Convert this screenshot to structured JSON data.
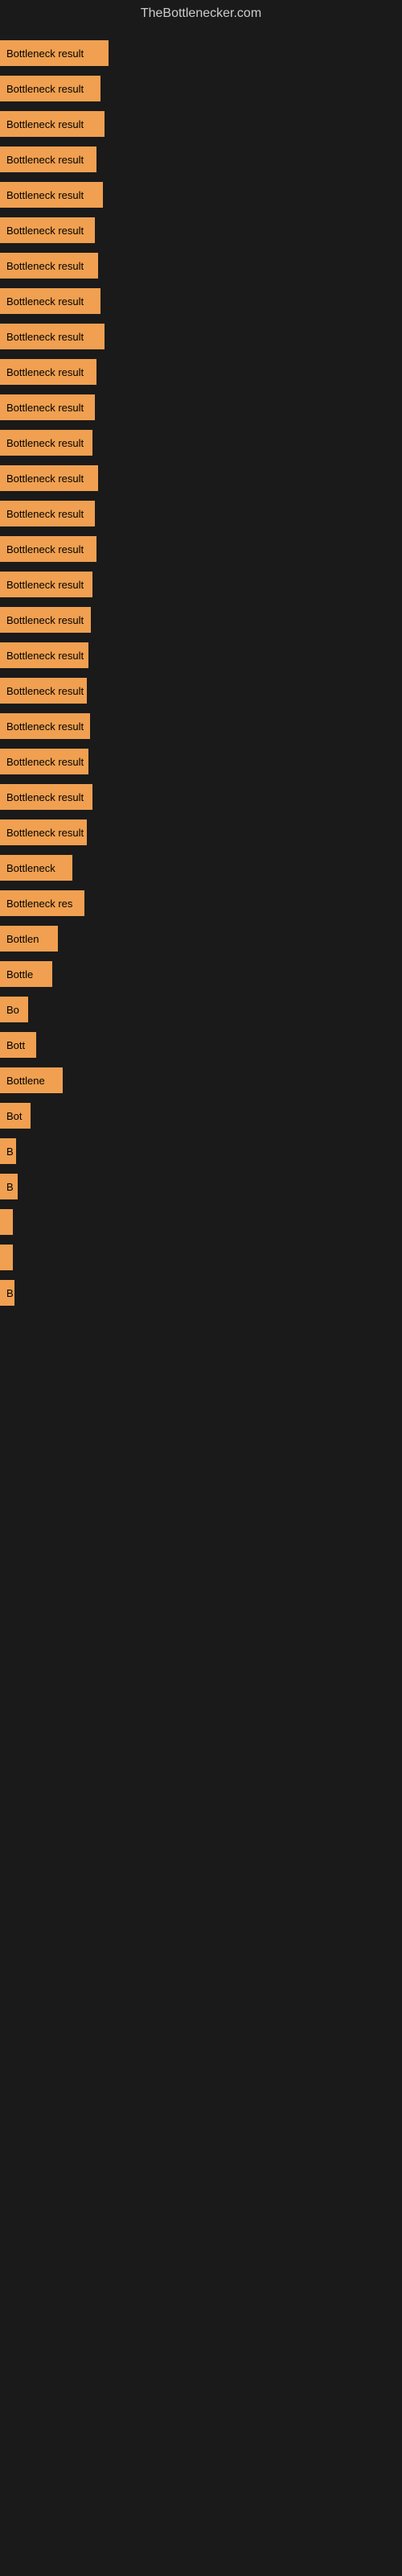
{
  "site": {
    "title": "TheBottlenecker.com"
  },
  "bars": [
    {
      "label": "Bottleneck result",
      "width": 135
    },
    {
      "label": "Bottleneck result",
      "width": 125
    },
    {
      "label": "Bottleneck result",
      "width": 130
    },
    {
      "label": "Bottleneck result",
      "width": 120
    },
    {
      "label": "Bottleneck result",
      "width": 128
    },
    {
      "label": "Bottleneck result",
      "width": 118
    },
    {
      "label": "Bottleneck result",
      "width": 122
    },
    {
      "label": "Bottleneck result",
      "width": 125
    },
    {
      "label": "Bottleneck result",
      "width": 130
    },
    {
      "label": "Bottleneck result",
      "width": 120
    },
    {
      "label": "Bottleneck result",
      "width": 118
    },
    {
      "label": "Bottleneck result",
      "width": 115
    },
    {
      "label": "Bottleneck result",
      "width": 122
    },
    {
      "label": "Bottleneck result",
      "width": 118
    },
    {
      "label": "Bottleneck result",
      "width": 120
    },
    {
      "label": "Bottleneck result",
      "width": 115
    },
    {
      "label": "Bottleneck result",
      "width": 113
    },
    {
      "label": "Bottleneck result",
      "width": 110
    },
    {
      "label": "Bottleneck result",
      "width": 108
    },
    {
      "label": "Bottleneck result",
      "width": 112
    },
    {
      "label": "Bottleneck result",
      "width": 110
    },
    {
      "label": "Bottleneck result",
      "width": 115
    },
    {
      "label": "Bottleneck result",
      "width": 108
    },
    {
      "label": "Bottleneck",
      "width": 90
    },
    {
      "label": "Bottleneck res",
      "width": 105
    },
    {
      "label": "Bottlen",
      "width": 72
    },
    {
      "label": "Bottle",
      "width": 65
    },
    {
      "label": "Bo",
      "width": 35
    },
    {
      "label": "Bott",
      "width": 45
    },
    {
      "label": "Bottlene",
      "width": 78
    },
    {
      "label": "Bot",
      "width": 38
    },
    {
      "label": "B",
      "width": 20
    },
    {
      "label": "B",
      "width": 22
    },
    {
      "label": "",
      "width": 10
    },
    {
      "label": "",
      "width": 8
    },
    {
      "label": "B",
      "width": 18
    }
  ]
}
